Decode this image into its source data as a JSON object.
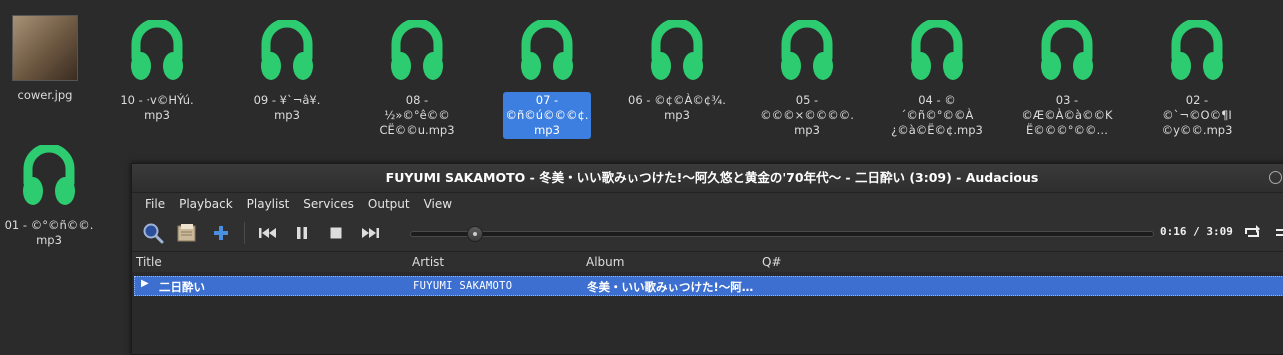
{
  "desktop": {
    "icons": [
      {
        "label": "cower.jpg",
        "type": "image"
      },
      {
        "label": "10 - ·v©HÝú.\nmp3",
        "type": "audio"
      },
      {
        "label": "09 - ¥`¬â¥.\nmp3",
        "type": "audio"
      },
      {
        "label": "08 -\n½»©°ê©©\nCË©©u.mp3",
        "type": "audio"
      },
      {
        "label": "07 -\n©ñ©ú©©©¢.\nmp3",
        "type": "audio",
        "selected": true
      },
      {
        "label": "06 - ©¢©À©¢¾.\nmp3",
        "type": "audio"
      },
      {
        "label": "05 -\n©©©×©©©©.\nmp3",
        "type": "audio"
      },
      {
        "label": "04 - ©\n´©ñ©°©©À\n¿©à©Ë©¢.mp3",
        "type": "audio"
      },
      {
        "label": "03 -\n©Æ©À©à©©K\nË©©©°©©…",
        "type": "audio"
      },
      {
        "label": "02 -\n©`¬©O©¶I\n©y©©.mp3",
        "type": "audio"
      },
      {
        "label": "01 - ©°©ñ©©.\nmp3",
        "type": "audio"
      }
    ]
  },
  "window": {
    "title": "FUYUMI SAKAMOTO - 冬美・いい歌みぃつけた!〜阿久悠と黄金の'70年代〜 - 二日酔い (3:09) - Audacious",
    "menu": [
      "File",
      "Playback",
      "Playlist",
      "Services",
      "Output",
      "View"
    ],
    "menu_accel": [
      "F",
      "P",
      "l",
      "S",
      "O",
      "V"
    ],
    "toolbar": {
      "search_icon": "search-icon",
      "open_icon": "open-files-icon",
      "add_icon": "add-icon",
      "prev_icon": "previous-icon",
      "pause_icon": "pause-icon",
      "stop_icon": "stop-icon",
      "next_icon": "next-icon",
      "repeat_icon": "repeat-icon",
      "shuffle_icon": "shuffle-icon"
    },
    "seek_fraction": 0.085,
    "time": "0:16 / 3:09",
    "columns": [
      "Title",
      "Artist",
      "Album",
      "Q#"
    ],
    "rows": [
      {
        "title": "二日酔い",
        "artist": "FUYUMI SAKAMOTO",
        "album": "冬美・いい歌みぃつけた!〜阿…",
        "queue": ""
      }
    ]
  },
  "colors": {
    "accent": "#3d7fe0",
    "music_icon": "#2ecc71",
    "row_selected": "#3c6fd0"
  }
}
